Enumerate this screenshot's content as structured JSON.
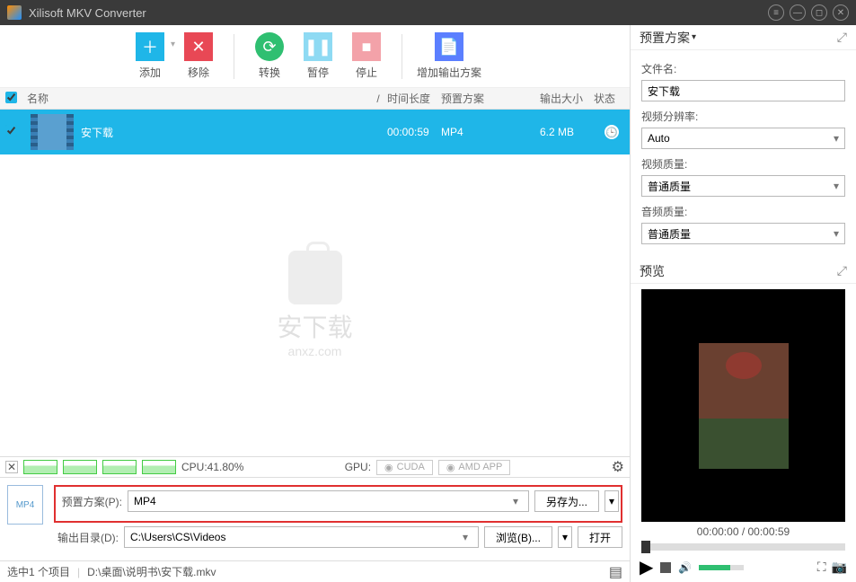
{
  "titlebar": {
    "title": "Xilisoft MKV Converter"
  },
  "toolbar": {
    "add": "添加",
    "remove": "移除",
    "convert": "转换",
    "pause": "暂停",
    "stop": "停止",
    "profile": "增加输出方案"
  },
  "columns": {
    "name": "名称",
    "slash": "/",
    "duration": "时间长度",
    "preset": "预置方案",
    "size": "输出大小",
    "status": "状态"
  },
  "rows": [
    {
      "name": "安下载",
      "duration": "00:00:59",
      "preset": "MP4",
      "size": "6.2 MB"
    }
  ],
  "watermark": {
    "big": "安下载",
    "small": "anxz.com"
  },
  "cpu": {
    "label": "CPU:41.80%",
    "gpu_label": "GPU:",
    "cuda": "CUDA",
    "amd": "AMD APP"
  },
  "bottom": {
    "preset_label": "预置方案(P):",
    "preset_value": "MP4",
    "saveas": "另存为...",
    "output_label": "输出目录(D):",
    "output_value": "C:\\Users\\CS\\Videos",
    "browse": "浏览(B)...",
    "open": "打开"
  },
  "statusbar": {
    "selected": "选中1 个项目",
    "path": "D:\\桌面\\说明书\\安下载.mkv"
  },
  "preset_panel": {
    "title": "预置方案",
    "filename_label": "文件名:",
    "filename_value": "安下载",
    "resolution_label": "视频分辨率:",
    "resolution_value": "Auto",
    "vquality_label": "视频质量:",
    "vquality_value": "普通质量",
    "aquality_label": "音频质量:",
    "aquality_value": "普通质量"
  },
  "preview": {
    "title": "预览",
    "time": "00:00:00 / 00:00:59"
  }
}
